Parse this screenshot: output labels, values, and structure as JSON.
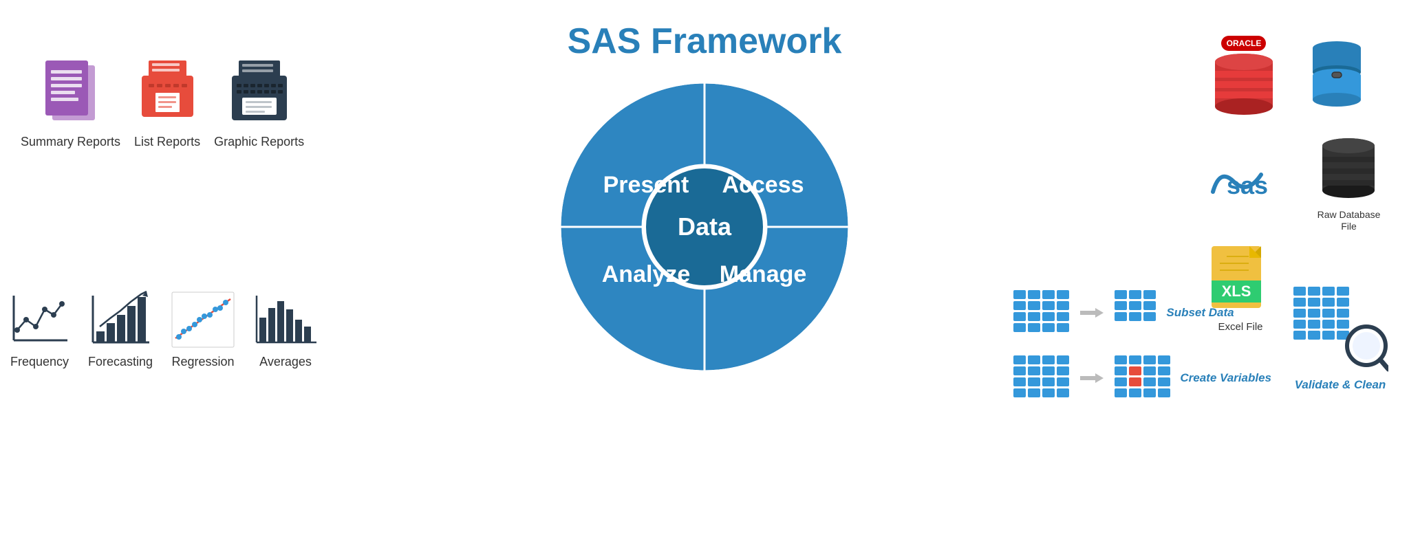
{
  "title": "SAS Framework",
  "wheel": {
    "sections": [
      {
        "id": "present",
        "label": "Present",
        "angle_start": 180,
        "angle_end": 270
      },
      {
        "id": "access",
        "label": "Access",
        "angle_start": 270,
        "angle_end": 360
      },
      {
        "id": "manage",
        "label": "Manage",
        "angle_start": 0,
        "angle_end": 90
      },
      {
        "id": "analyze",
        "label": "Analyze",
        "angle_start": 90,
        "angle_end": 180
      }
    ],
    "center_label": "Data",
    "outer_color": "#2980b9",
    "inner_color": "#1a6a96",
    "center_color": "#1e5f8a",
    "line_color": "white",
    "text_color": "white"
  },
  "left_reports": {
    "items": [
      {
        "id": "summary-reports",
        "label": "Summary Reports",
        "color": "#9b59b6"
      },
      {
        "id": "list-reports",
        "label": "List Reports",
        "color": "#e74c3c"
      },
      {
        "id": "graphic-reports",
        "label": "Graphic Reports",
        "color": "#2c3e50"
      }
    ]
  },
  "left_analyze": {
    "items": [
      {
        "id": "frequency",
        "label": "Frequency"
      },
      {
        "id": "forecasting",
        "label": "Forecasting"
      },
      {
        "id": "regression",
        "label": "Regression"
      },
      {
        "id": "averages",
        "label": "Averages"
      }
    ]
  },
  "right_sources": {
    "rows": [
      {
        "items": [
          {
            "id": "oracle-db",
            "label": "",
            "type": "oracle"
          },
          {
            "id": "chain-db",
            "label": "",
            "type": "chain"
          }
        ]
      },
      {
        "items": [
          {
            "id": "sas-logo",
            "label": "",
            "type": "sas"
          },
          {
            "id": "raw-db",
            "label": "Raw Database\nFile",
            "type": "black-db"
          }
        ]
      },
      {
        "items": [
          {
            "id": "excel-file",
            "label": "Excel File",
            "type": "excel"
          }
        ]
      }
    ]
  },
  "right_manage": {
    "rows": [
      {
        "id": "subset-data",
        "label": "Subset Data"
      },
      {
        "id": "create-variables",
        "label": "Create Variables"
      }
    ],
    "validate_label": "Validate & Clean"
  }
}
